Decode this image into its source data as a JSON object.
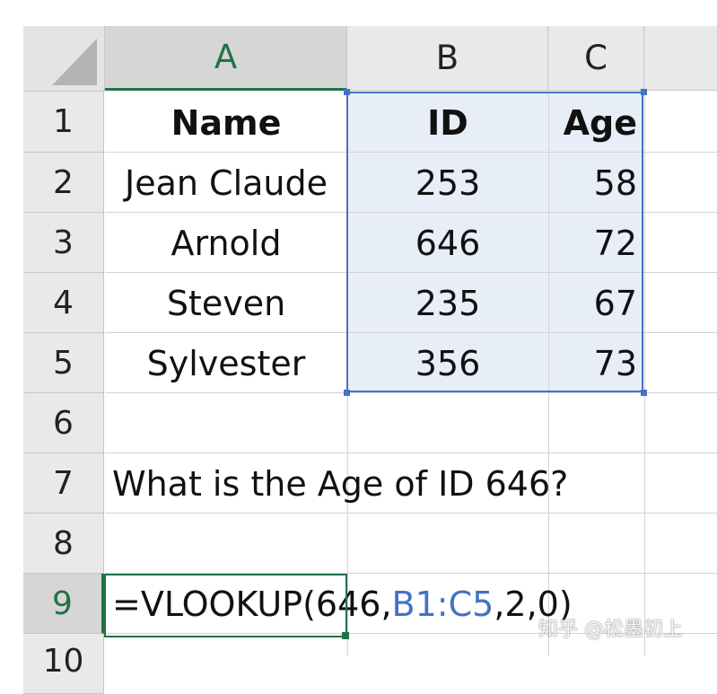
{
  "columns": [
    "A",
    "B",
    "C"
  ],
  "rows": [
    "1",
    "2",
    "3",
    "4",
    "5",
    "6",
    "7",
    "8",
    "9",
    "10"
  ],
  "table": {
    "headers": [
      "Name",
      "ID",
      "Age"
    ],
    "records": [
      [
        "Jean Claude",
        "253",
        "58"
      ],
      [
        "Arnold",
        "646",
        "72"
      ],
      [
        "Steven",
        "235",
        "67"
      ],
      [
        "Sylvester",
        "356",
        "73"
      ]
    ]
  },
  "question": "What is the Age of ID 646?",
  "formula": {
    "prefix": "=VLOOKUP(646,",
    "range": "B1:C5",
    "suffix": ",2,0)"
  },
  "selection": {
    "active_cell": "A9",
    "highlighted_range": "B1:C5"
  },
  "colors": {
    "range_highlight": "#4472c4",
    "active": "#217346"
  },
  "watermark": "知乎 @松墨初上"
}
